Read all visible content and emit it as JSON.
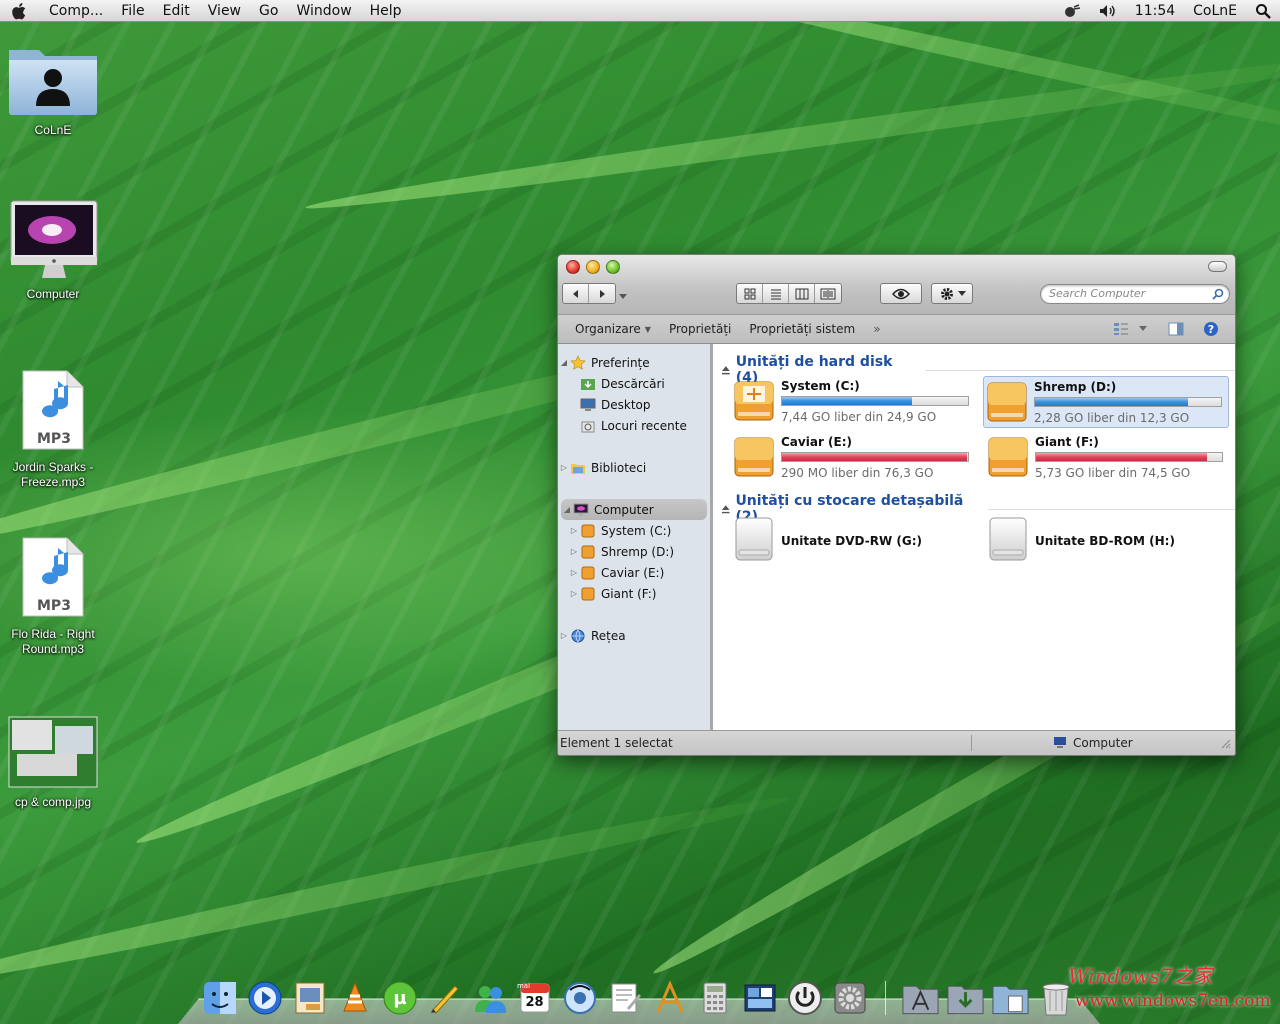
{
  "menubar": {
    "app": "Comp...",
    "items": [
      "File",
      "Edit",
      "View",
      "Go",
      "Window",
      "Help"
    ],
    "clock": "11:54",
    "user": "CoLnE"
  },
  "desktop": {
    "icons": [
      {
        "label": "CoLnE",
        "icon": "user-folder-icon"
      },
      {
        "label": "Computer",
        "icon": "imac-icon"
      },
      {
        "label": "Jordin Sparks - Freeze.mp3",
        "icon": "mp3-file-icon",
        "badge": "MP3"
      },
      {
        "label": "Flo Rida - Right Round.mp3",
        "icon": "mp3-file-icon",
        "badge": "MP3"
      },
      {
        "label": "cp & comp.jpg",
        "icon": "image-thumbnail-icon"
      }
    ]
  },
  "window": {
    "search_placeholder": "Search Computer",
    "commands": {
      "organize": "Organizare",
      "properties": "Proprietăți",
      "system_properties": "Proprietăți sistem",
      "more": "»"
    },
    "sidebar": {
      "favorites": "Preferințe",
      "downloads": "Descărcări",
      "desktop": "Desktop",
      "recent": "Locuri recente",
      "libraries": "Biblioteci",
      "computer": "Computer",
      "drive_c": "System (C:)",
      "drive_d": "Shremp (D:)",
      "drive_e": "Caviar (E:)",
      "drive_f": "Giant (F:)",
      "network": "Rețea"
    },
    "hard_disks": {
      "title": "Unități de hard disk (4)",
      "drives": [
        {
          "name": "System (C:)",
          "free": "7,44 GO liber din 24,9 GO",
          "used_fraction": 0.7,
          "color": "#3c8ee0"
        },
        {
          "name": "Shremp (D:)",
          "free": "2,28 GO liber din 12,3 GO",
          "used_fraction": 0.82,
          "color": "#3c8ee0"
        },
        {
          "name": "Caviar (E:)",
          "free": "290 MO liber din 76,3 GO",
          "used_fraction": 0.996,
          "color": "#e2445a"
        },
        {
          "name": "Giant (F:)",
          "free": "5,73 GO liber din 74,5 GO",
          "used_fraction": 0.92,
          "color": "#e2445a"
        }
      ]
    },
    "removable": {
      "title": "Unități cu stocare detașabilă (2)",
      "drives": [
        {
          "name": "Unitate DVD-RW (G:)"
        },
        {
          "name": "Unitate BD-ROM (H:)"
        }
      ]
    },
    "status": {
      "selection": "Element 1 selectat",
      "location": "Computer"
    }
  },
  "dock": {
    "icons": [
      "finder-icon",
      "quicktime-icon",
      "preview-icon",
      "vlc-icon",
      "utorrent-icon",
      "pen-icon",
      "messenger-icon",
      "calendar-icon",
      "itunes-icon",
      "textedit-icon",
      "font-icon",
      "calculator-icon",
      "dashboard-icon",
      "power-icon",
      "settings-icon",
      "applications-icon",
      "downloads-icon",
      "documents-icon",
      "trash-icon"
    ],
    "calendar": {
      "month": "mai",
      "day": "28"
    }
  },
  "watermark": {
    "text": "Windows7之家",
    "url": "www.windows7en.com"
  }
}
